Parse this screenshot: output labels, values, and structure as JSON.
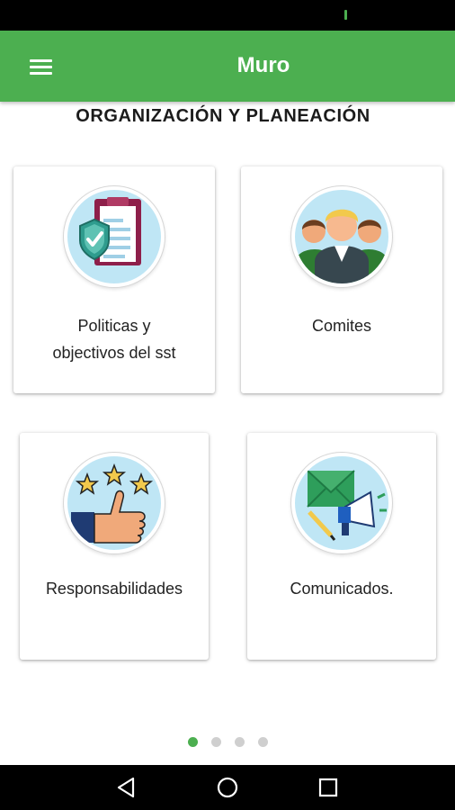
{
  "app_bar": {
    "title": "Muro",
    "color": "#4caf50"
  },
  "section": {
    "title": "ORGANIZACIÓN Y PLANEACIÓN"
  },
  "cards": [
    {
      "label_line1": "Politicas y",
      "label_line2": "objectivos del sst",
      "icon": "clipboard-shield-icon"
    },
    {
      "label": "Comites",
      "icon": "team-icon"
    },
    {
      "label": "Responsabilidades",
      "icon": "thumbs-up-stars-icon"
    },
    {
      "label": "Comunicados.",
      "icon": "megaphone-envelope-icon"
    }
  ],
  "pager": {
    "page_count": 4,
    "active_page": 1
  },
  "nav_bar": {
    "icons": [
      "back-icon",
      "home-icon",
      "recents-icon"
    ]
  }
}
